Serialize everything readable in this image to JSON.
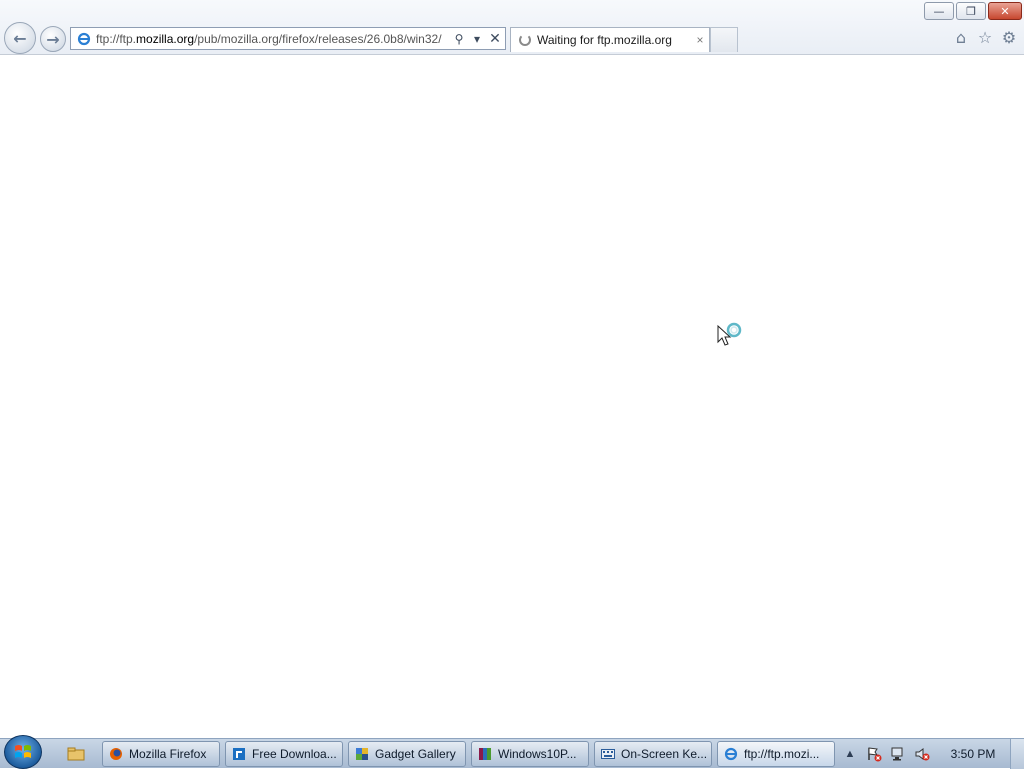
{
  "window": {
    "minimize_icon": "minimize-icon",
    "restore_icon": "restore-icon",
    "close_icon": "close-icon"
  },
  "navigation": {
    "back_icon": "back-arrow-icon",
    "forward_icon": "forward-arrow-icon"
  },
  "address_bar": {
    "url_prefix": "ftp://ftp.",
    "url_host": "mozilla.org",
    "url_path": "/pub/mozilla.org/firefox/releases/26.0b8/win32/",
    "search_icon": "search-icon",
    "dropdown_icon": "chevron-down-icon",
    "stop_icon": "stop-icon"
  },
  "tab": {
    "title": "Waiting for ftp.mozilla.org",
    "close_glyph": "×"
  },
  "toolbar_icons": [
    "home-icon",
    "favorites-star-icon",
    "tools-gear-icon"
  ],
  "taskbar": {
    "tasks": [
      {
        "label": "Mozilla Firefox",
        "icon": "firefox-icon"
      },
      {
        "label": "Free Downloa...",
        "icon": "download-manager-icon"
      },
      {
        "label": "Gadget Gallery",
        "icon": "gadget-icon"
      },
      {
        "label": "Windows10P...",
        "icon": "winrar-icon"
      },
      {
        "label": "On-Screen Ke...",
        "icon": "keyboard-icon"
      },
      {
        "label": "ftp://ftp.mozi...",
        "icon": "ie-icon"
      }
    ],
    "clock": "3:50 PM"
  },
  "colors": {
    "chrome_bg": "#e9eef5",
    "taskbar_bg": "#a7bad1",
    "close_button": "#c7472f"
  }
}
